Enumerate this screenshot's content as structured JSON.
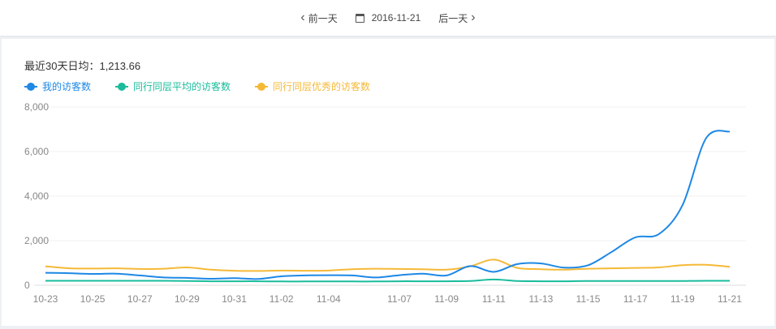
{
  "nav": {
    "prev_label": "前一天",
    "date": "2016-11-21",
    "next_label": "后一天",
    "prev_icon": "chevron-left-icon",
    "next_icon": "chevron-right-icon",
    "calendar_icon": "calendar-icon"
  },
  "summary": {
    "avg_label": "最近30天日均：",
    "avg_value": "1,213.66"
  },
  "chart_data": {
    "type": "line",
    "title": "",
    "xlabel": "",
    "ylabel": "",
    "ylim": [
      0,
      8000
    ],
    "yticks": [
      "0",
      "2,000",
      "4,000",
      "6,000",
      "8,000"
    ],
    "yticks_values": [
      0,
      2000,
      4000,
      6000,
      8000
    ],
    "x": [
      "10-23",
      "10-24",
      "10-25",
      "10-26",
      "10-27",
      "10-28",
      "10-29",
      "10-30",
      "10-31",
      "11-01",
      "11-02",
      "11-03",
      "11-04",
      "11-05",
      "11-06",
      "11-07",
      "11-08",
      "11-09",
      "11-10",
      "11-11",
      "11-12",
      "11-13",
      "11-14",
      "11-15",
      "11-16",
      "11-17",
      "11-18",
      "11-19",
      "11-20",
      "11-21"
    ],
    "xticks": [
      "10-23",
      "10-25",
      "10-27",
      "10-29",
      "10-31",
      "11-02",
      "11-04",
      "11-07",
      "11-09",
      "11-11",
      "11-13",
      "11-15",
      "11-17",
      "11-19",
      "11-21"
    ],
    "grid": true,
    "legend_position": "top-left",
    "series": [
      {
        "name": "我的访客数",
        "color": "#1e88e5",
        "values": [
          560,
          540,
          510,
          520,
          440,
          350,
          330,
          290,
          320,
          280,
          400,
          440,
          450,
          440,
          350,
          450,
          520,
          440,
          860,
          600,
          950,
          980,
          790,
          900,
          1500,
          2150,
          2300,
          3600,
          6600,
          6900
        ]
      },
      {
        "name": "同行同层平均的访客数",
        "color": "#1abc9c",
        "values": [
          200,
          200,
          200,
          200,
          200,
          200,
          190,
          180,
          180,
          180,
          170,
          170,
          170,
          170,
          170,
          180,
          180,
          180,
          190,
          260,
          190,
          180,
          180,
          190,
          190,
          190,
          190,
          190,
          200,
          200
        ]
      },
      {
        "name": "同行同层优秀的访客数",
        "color": "#f5b937",
        "values": [
          850,
          760,
          750,
          760,
          730,
          740,
          800,
          700,
          650,
          640,
          660,
          650,
          660,
          720,
          740,
          730,
          720,
          700,
          850,
          1150,
          780,
          720,
          700,
          740,
          760,
          780,
          800,
          900,
          920,
          830
        ]
      }
    ]
  }
}
